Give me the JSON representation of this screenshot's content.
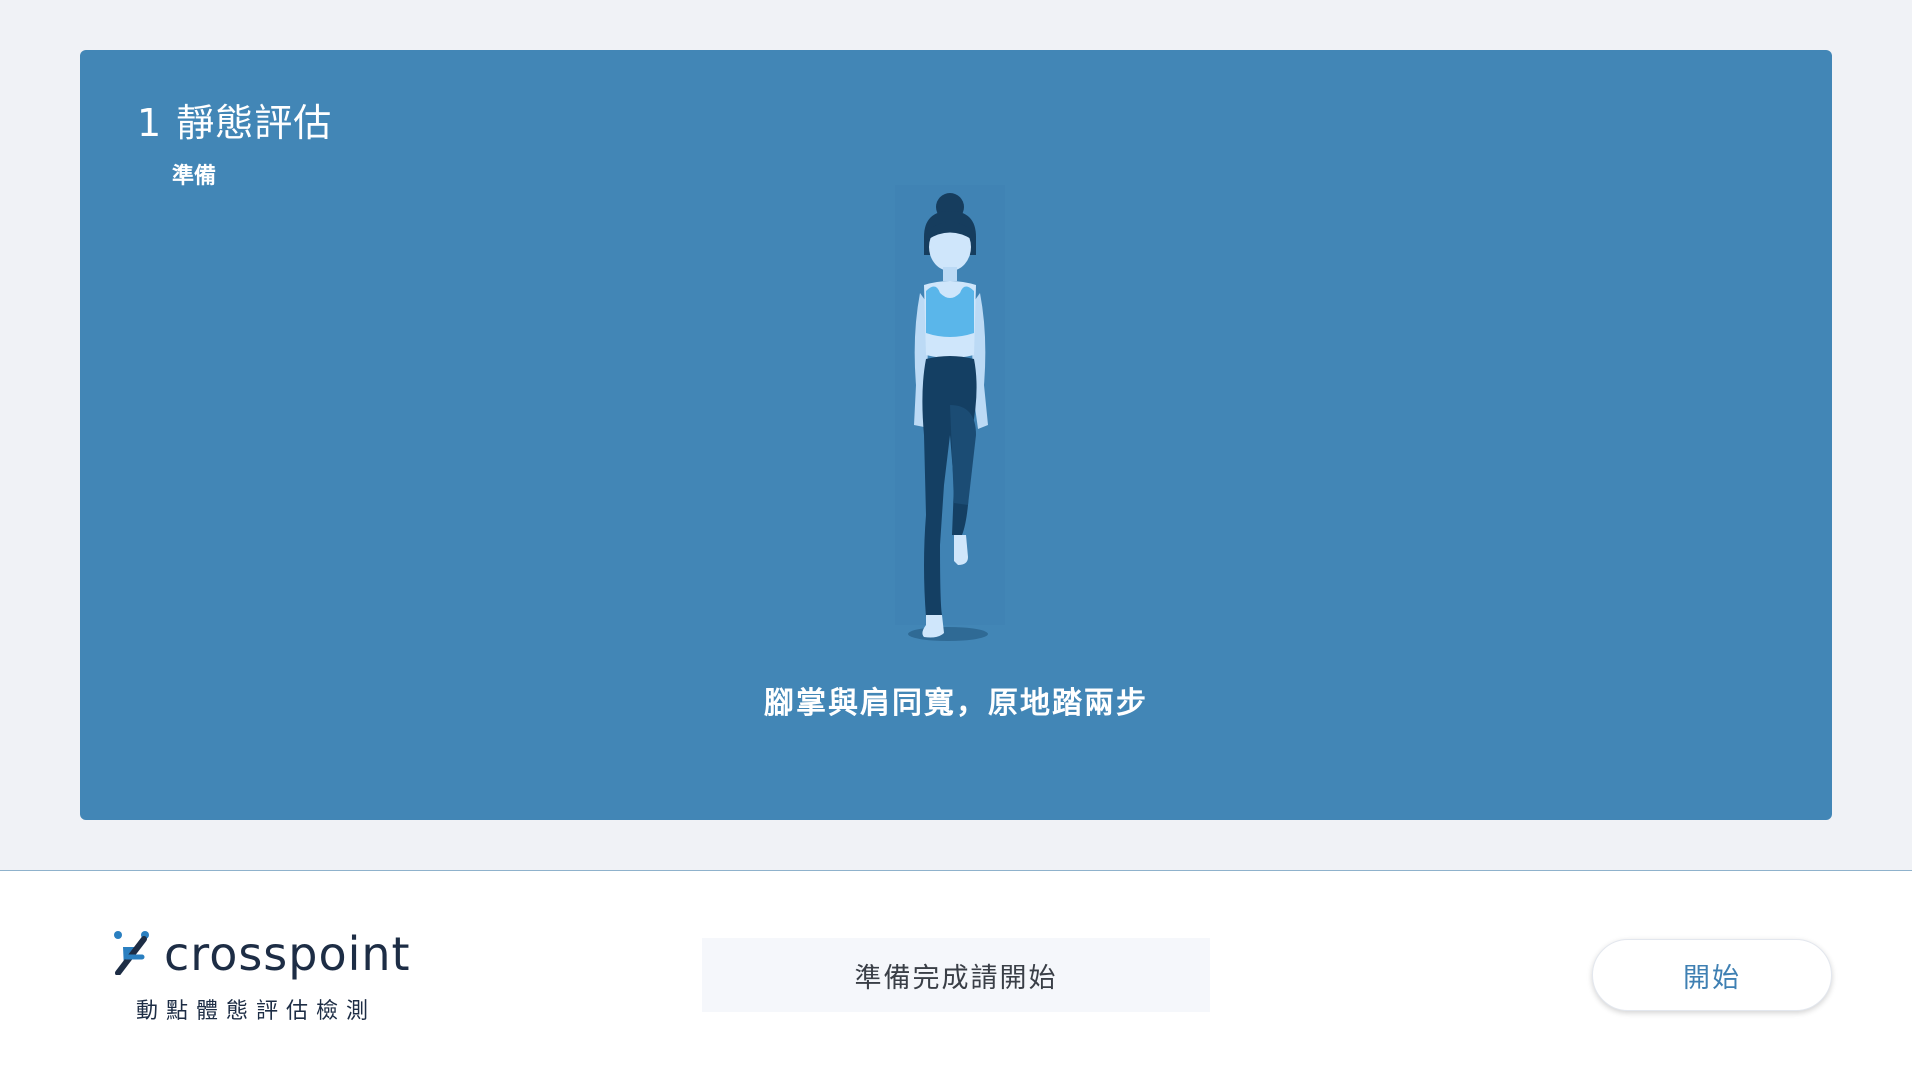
{
  "step": {
    "number": "1",
    "title": "靜態評估",
    "subtitle": "準備"
  },
  "instruction": "腳掌與肩同寬，原地踏兩步",
  "footer": {
    "brand_name": "crosspoint",
    "brand_tagline": "動點體態評估檢測",
    "status_text": "準備完成請開始",
    "start_label": "開始"
  },
  "icons": [
    "crosspoint-logo-icon",
    "standing-woman-illustration"
  ],
  "colors": {
    "panel": "#4286b6",
    "page_bg": "#f0f2f6",
    "accent": "#3f80b3",
    "logo_blue": "#2a7fc0",
    "logo_dark": "#1d2d45"
  }
}
